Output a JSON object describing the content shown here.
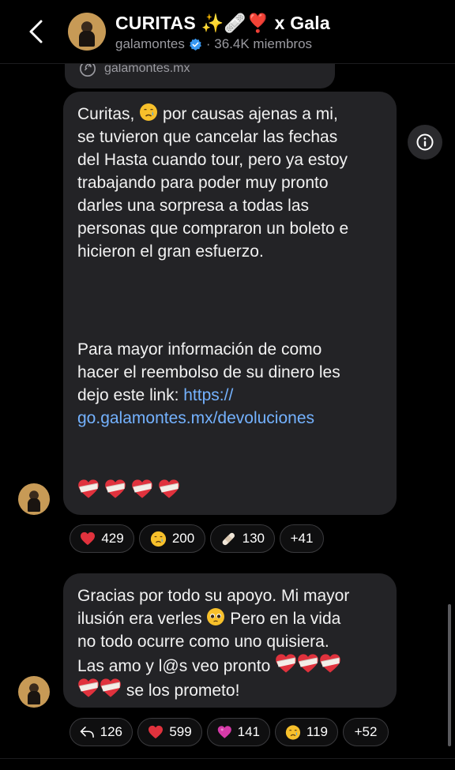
{
  "header": {
    "title": "CURITAS ✨🩹❣️ x Gala",
    "handle": "galamontes",
    "members": "· 36.4K miembros"
  },
  "prev_message": {
    "link_text": "galamontes.mx"
  },
  "message1": {
    "line_a_pre": "Curitas, ",
    "line_a_post": " por causas ajenas a mi,\nse tuvieron que cancelar las fechas\ndel Hasta cuando tour, pero ya estoy\ntrabajando para poder muy pronto\ndarles una sorpresa a todas las\npersonas que compraron un boleto e\nhicieron el gran esfuerzo.",
    "para2": "Para mayor información de como\nhacer el reembolso de su dinero les\ndejo este link: ",
    "link": "https://\ngo.galamontes.mx/devoluciones",
    "reactions": [
      {
        "icon": "red-heart-icon",
        "count": "429"
      },
      {
        "icon": "crying-face-icon",
        "count": "200"
      },
      {
        "icon": "bandage-icon",
        "count": "130"
      },
      {
        "icon": "",
        "count": "+41"
      }
    ]
  },
  "message2": {
    "text_a": "Gracias por todo su apoyo. Mi mayor\nilusión era verles ",
    "text_b": " Pero en la vida\nno todo ocurre como uno quisiera.\nLas amo y l@s veo pronto ",
    "text_c": " se los prometo!",
    "reactions": [
      {
        "icon": "reply-icon",
        "count": "126"
      },
      {
        "icon": "red-heart-icon",
        "count": "599"
      },
      {
        "icon": "purple-heart-icon",
        "count": "141"
      },
      {
        "icon": "crying-face-icon",
        "count": "119"
      },
      {
        "icon": "",
        "count": "+52"
      }
    ]
  },
  "colors": {
    "background": "#000000",
    "bubble": "#232326",
    "link": "#74b2ff",
    "verified": "#3897f0"
  }
}
